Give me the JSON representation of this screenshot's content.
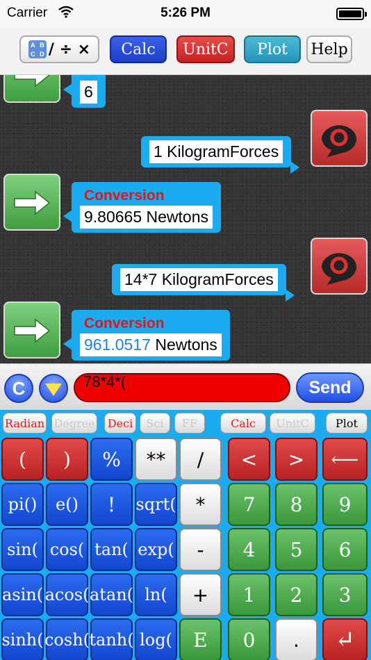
{
  "status": {
    "carrier": "Carrier",
    "time": "5:26 PM"
  },
  "toolbar": {
    "mode_symbols": "/ ÷ ×",
    "calc": "Calc",
    "unitc": "UnitC",
    "plot": "Plot",
    "help": "Help"
  },
  "chat": {
    "messages": [
      {
        "side": "left",
        "header": "",
        "body": "6"
      },
      {
        "side": "right",
        "header": "",
        "body": "1 KilogramForces"
      },
      {
        "side": "left",
        "header": "Conversion",
        "body": "9.80665 Newtons"
      },
      {
        "side": "right",
        "header": "",
        "body": "14*7 KilogramForces"
      },
      {
        "side": "left",
        "header": "Conversion",
        "body_number": "961.0517",
        "body_unit": " Newtons"
      }
    ]
  },
  "input": {
    "clear": "C",
    "expression": "78*4*(",
    "send": "Send"
  },
  "keyboard": {
    "modes": [
      "Radian",
      "Degree",
      "Deci",
      "Sci",
      "FF",
      "Calc",
      "UnitC",
      "Plot"
    ],
    "rows": [
      [
        "(",
        ")",
        "%",
        "**",
        "/",
        "<",
        ">",
        "⟵"
      ],
      [
        "pi()",
        "e()",
        "!",
        "sqrt(",
        "*",
        "7",
        "8",
        "9"
      ],
      [
        "sin(",
        "cos(",
        "tan(",
        "exp(",
        "-",
        "4",
        "5",
        "6"
      ],
      [
        "asin(",
        "acos(",
        "atan(",
        "ln(",
        "+",
        "1",
        "2",
        "3"
      ],
      [
        "sinh(",
        "cosh(",
        "tanh(",
        "log(",
        "E",
        "0",
        ".",
        "↵"
      ]
    ]
  },
  "colors": {
    "accent_blue": "#1aabf0",
    "input_red": "#f00000",
    "conversion_red": "#e41616"
  }
}
